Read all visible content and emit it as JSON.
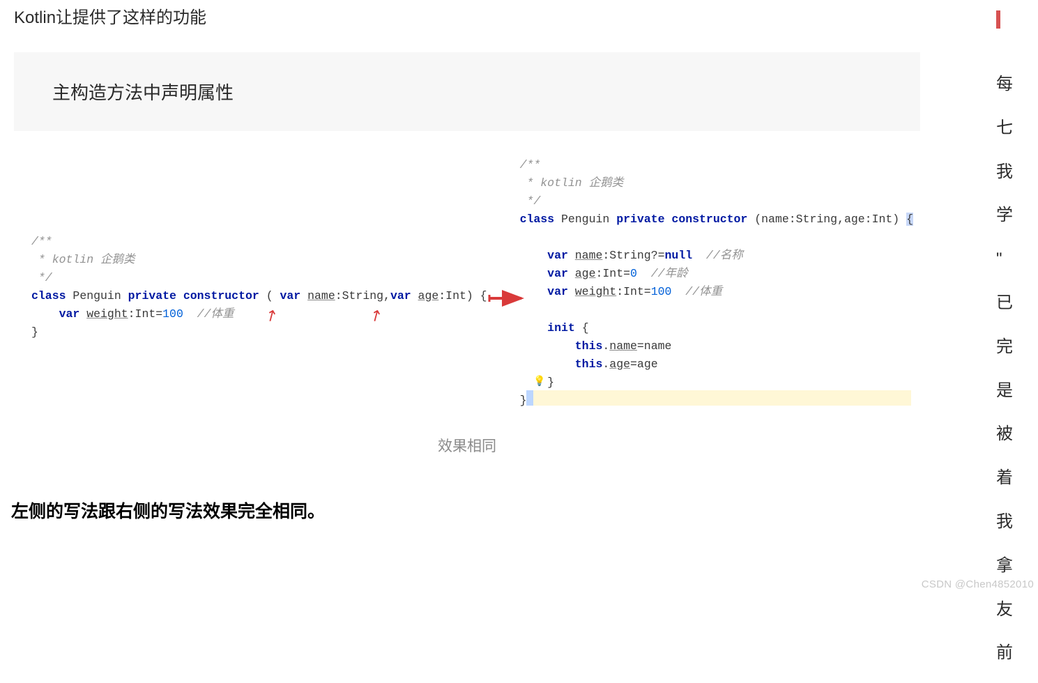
{
  "intro": "Kotlin让提供了这样的功能",
  "blockquote": "主构造方法中声明属性",
  "left_code": {
    "doc1": "/**",
    "doc2": " * kotlin 企鹅类",
    "doc3": " */",
    "kw_class": "class",
    "cls_name": " Penguin ",
    "kw_private": "private",
    "kw_constructor": " constructor ",
    "lp": "( ",
    "kw_var1": "var ",
    "p_name": "name",
    "p_name_t": ":String,",
    "kw_var2": "var ",
    "p_age": "age",
    "p_age_t": ":Int) {",
    "indent_var": "    ",
    "kw_var3": "var ",
    "p_weight": "weight",
    "p_weight_t": ":Int=",
    "num100": "100",
    "c_weight": "  //体重",
    "close": "}"
  },
  "right_code": {
    "doc1": "/**",
    "doc2": " * kotlin 企鹅类",
    "doc3": " */",
    "kw_class": "class",
    "cls_name": " Penguin ",
    "kw_private": "private",
    "kw_constructor": " constructor ",
    "params": "(name:String,age:Int) ",
    "brace_open": "{",
    "blank1": "",
    "indent": "    ",
    "kw_var1": "var ",
    "p_name": "name",
    "p_name_t": ":String?=",
    "kw_null": "null",
    "c_name": "  //名称",
    "kw_var2": "var ",
    "p_age": "age",
    "p_age_t": ":Int=",
    "num0": "0",
    "c_age": "  //年龄",
    "kw_var3": "var ",
    "p_weight": "weight",
    "p_weight_t": ":Int=",
    "num100": "100",
    "c_weight": "  //体重",
    "blank2": "",
    "kw_init": "init ",
    "init_open": "{",
    "indent2": "        ",
    "kw_this1": "this",
    "dot1": ".",
    "tn": "name",
    "eq_name": "=name",
    "kw_this2": "this",
    "dot2": ".",
    "ta": "age",
    "eq_age": "=age",
    "init_close": "}",
    "close": "}"
  },
  "caption": "效果相同",
  "statement": "左侧的写法跟右侧的写法效果完全相同。",
  "sidebar": {
    "s1": "每",
    "s2": "七",
    "s3": "我",
    "s4": "学",
    "s5": "\"",
    "s6": "已",
    "s7": "完",
    "s8": "是",
    "s9": "被",
    "s10": "着",
    "s11": "我",
    "s12": "拿",
    "s13": "友",
    "s14": "前"
  },
  "watermark": "CSDN @Chen4852010"
}
